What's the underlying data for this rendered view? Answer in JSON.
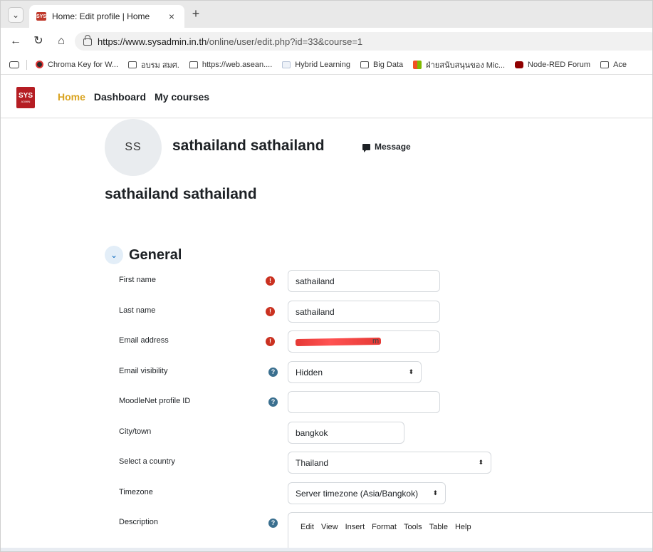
{
  "browser": {
    "tab_title": "Home: Edit profile | Home",
    "tab_close": "×",
    "new_tab": "+",
    "favicon_text": "SYS",
    "url_domain": "https://www.sysadmin.in.th",
    "url_path": "/online/user/edit.php?id=33&course=1",
    "bookmarks": [
      {
        "icon": "chroma-icon",
        "label": "Chroma Key for W..."
      },
      {
        "icon": "folder-icon",
        "label": "อบรม สมศ."
      },
      {
        "icon": "home-icon",
        "label": "https://web.asean...."
      },
      {
        "icon": "page-icon",
        "label": "Hybrid Learning"
      },
      {
        "icon": "folder-icon",
        "label": "Big Data"
      },
      {
        "icon": "microsoft-icon",
        "label": "ฝ่ายสนับสนุนของ Mic..."
      },
      {
        "icon": "node-red-icon",
        "label": "Node-RED Forum"
      },
      {
        "icon": "folder-icon",
        "label": "Ace"
      }
    ]
  },
  "site": {
    "logo_line1": "SYS",
    "logo_line2": "ADMIN",
    "nav": {
      "home": "Home",
      "dashboard": "Dashboard",
      "my_courses": "My courses"
    }
  },
  "profile": {
    "initials": "SS",
    "full_name": "sathailand sathailand",
    "message_label": "Message",
    "heading": "sathailand sathailand"
  },
  "form": {
    "section_title": "General",
    "first_name_label": "First name",
    "first_name_value": "sathailand",
    "last_name_label": "Last name",
    "last_name_value": "sathailand",
    "email_label": "Email address",
    "email_value_tail": "m",
    "email_visibility_label": "Email visibility",
    "email_visibility_value": "Hidden",
    "moodlenet_label": "MoodleNet profile ID",
    "moodlenet_value": "",
    "city_label": "City/town",
    "city_value": "bangkok",
    "country_label": "Select a country",
    "country_value": "Thailand",
    "timezone_label": "Timezone",
    "timezone_value": "Server timezone (Asia/Bangkok)",
    "description_label": "Description",
    "editor_menu": [
      "Edit",
      "View",
      "Insert",
      "Format",
      "Tools",
      "Table",
      "Help"
    ]
  },
  "colors": {
    "accent": "#d9a320",
    "required": "#ca3120",
    "help": "#3a6f8f",
    "logo": "#b51d23"
  }
}
